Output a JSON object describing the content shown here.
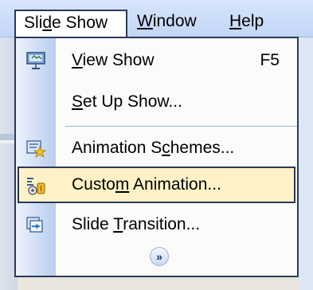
{
  "menubar": {
    "slide_show": {
      "pre": "Sli",
      "accel": "d",
      "post": "e Show"
    },
    "window": {
      "pre": "",
      "accel": "W",
      "post": "indow"
    },
    "help": {
      "pre": "",
      "accel": "H",
      "post": "elp"
    }
  },
  "menu": {
    "view_show": {
      "pre": "",
      "accel": "V",
      "post": "iew Show",
      "shortcut": "F5",
      "icon": "projector-screen-icon"
    },
    "setup_show": {
      "pre": "",
      "accel": "S",
      "post": "et Up Show...",
      "icon": ""
    },
    "animation_schemes": {
      "pre": "Animation S",
      "accel": "c",
      "post": "hemes...",
      "icon": "animation-schemes-icon"
    },
    "custom_animation": {
      "pre": "Custo",
      "accel": "m",
      "post": " Animation...",
      "icon": "custom-animation-icon"
    },
    "slide_transition": {
      "pre": "Slide ",
      "accel": "T",
      "post": "ransition...",
      "icon": "slide-transition-icon"
    },
    "expand": {
      "glyph": "»",
      "icon": "expand-menu-icon"
    }
  },
  "colors": {
    "highlight": "#fff2c6",
    "border": "#2a3a5a",
    "menubar": "#c3d6f7",
    "gutter": "#b8cdef"
  }
}
